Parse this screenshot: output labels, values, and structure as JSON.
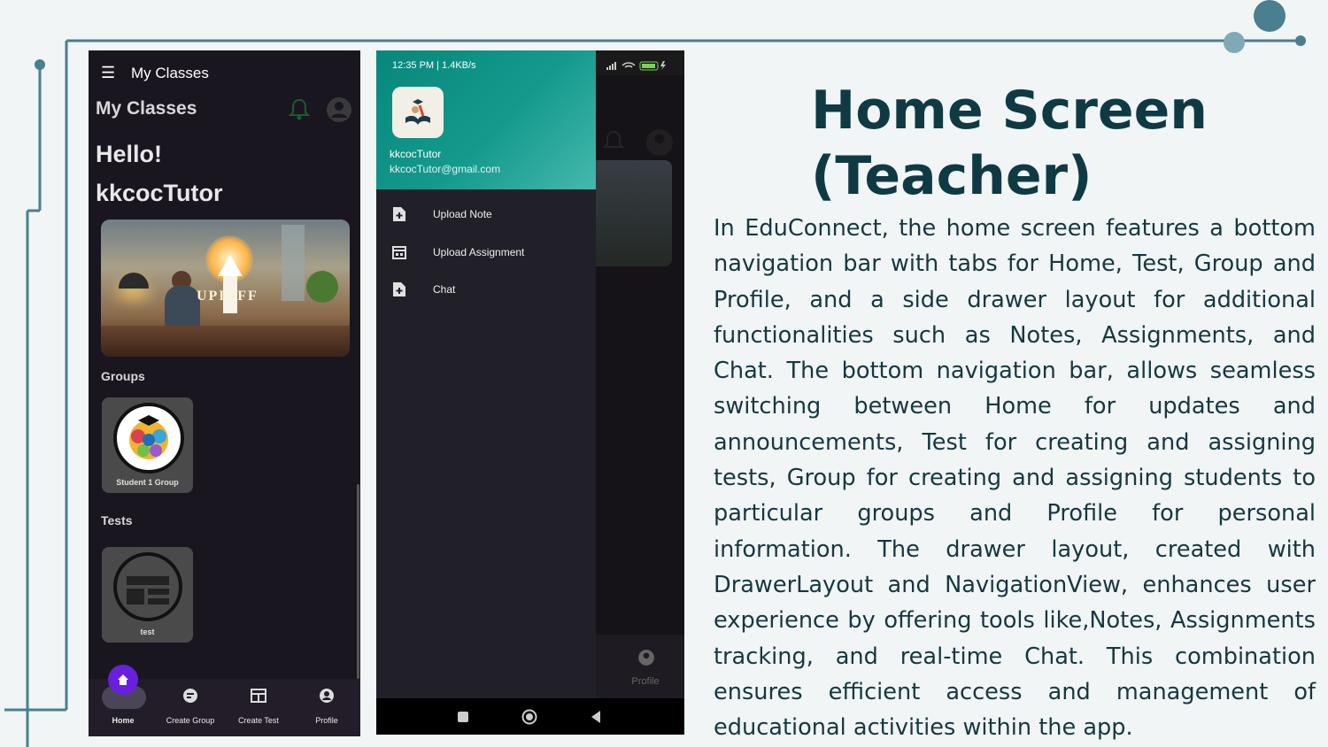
{
  "slide": {
    "heading": "Home Screen (Teacher)",
    "body": "In EduConnect, the home screen features a bottom navigation bar with tabs for Home, Test, Group and Profile, and a side drawer layout for additional functionalities such as Notes, Assignments, and Chat. The bottom navigation bar, allows seamless switching between Home for updates and announcements, Test for creating and assigning tests, Group for creating and assigning students to particular groups and Profile for personal information. The drawer layout, created with DrawerLayout and NavigationView, enhances user experience by offering tools like,Notes, Assignments tracking, and real-time Chat. This combination ensures efficient access and management of educational activities within the app.",
    "accent_color": "#4a7f8f",
    "heading_color": "#0f3a43"
  },
  "phone1": {
    "app_bar_title": "My Classes",
    "page_title": "My Classes",
    "greeting": "Hello!",
    "user_name": "kkcocTutor",
    "banner_text": "UPLIFF",
    "groups_title": "Groups",
    "group_card_label": "Student 1 Group",
    "tests_title": "Tests",
    "test_card_label": "test",
    "bottom_nav": [
      "Home",
      "Create Group",
      "Create Test",
      "Profile"
    ],
    "icons": {
      "menu": "hamburger-icon",
      "bell": "bell-icon",
      "avatar": "account-circle-icon"
    }
  },
  "phone2": {
    "status_time": "12:35 PM | 1.4KB/s",
    "battery": "79",
    "drawer_name": "kkcocTutor",
    "drawer_email": "kkcocTutor@gmail.com",
    "drawer_items": [
      "Upload Note",
      "Upload Assignment",
      "Chat"
    ],
    "behind_nav_label": "Profile",
    "header_gradient": [
      "#07877a",
      "#46b8ac"
    ]
  }
}
